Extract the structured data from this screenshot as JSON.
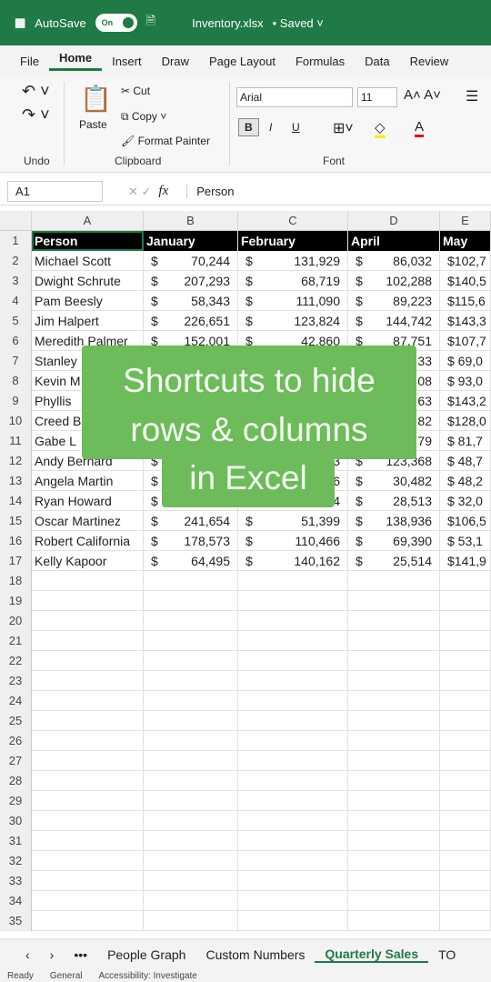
{
  "titlebar": {
    "autosave": "AutoSave",
    "toggle": "On",
    "filename": "Inventory.xlsx",
    "saved": "• Saved ˅"
  },
  "menu": [
    "File",
    "Home",
    "Insert",
    "Draw",
    "Page Layout",
    "Formulas",
    "Data",
    "Review"
  ],
  "ribbon": {
    "undo_group": "Undo",
    "paste": "Paste",
    "cut": "Cut",
    "copy": "Copy",
    "format_painter": "Format Painter",
    "clipboard_group": "Clipboard",
    "font_name": "Arial",
    "font_size": "11",
    "bold": "B",
    "italic": "I",
    "underline": "U",
    "font_group": "Font"
  },
  "formula_bar": {
    "name_box": "A1",
    "fx": "fx",
    "value": "Person"
  },
  "columns": [
    "A",
    "B",
    "C",
    "D",
    "E"
  ],
  "header_row": [
    "Person",
    "January",
    "February",
    "April",
    "May"
  ],
  "rows": [
    {
      "n": "2",
      "name": "Michael Scott",
      "b": "70,244",
      "c": "131,929",
      "d": "86,032",
      "e": "$102,7"
    },
    {
      "n": "3",
      "name": "Dwight Schrute",
      "b": "207,293",
      "c": "68,719",
      "d": "102,288",
      "e": "$140,5"
    },
    {
      "n": "4",
      "name": "Pam Beesly",
      "b": "58,343",
      "c": "111,090",
      "d": "89,223",
      "e": "$115,6"
    },
    {
      "n": "5",
      "name": "Jim Halpert",
      "b": "226,651",
      "c": "123,824",
      "d": "144,742",
      "e": "$143,3"
    },
    {
      "n": "6",
      "name": "Meredith Palmer",
      "b": "152,001",
      "c": "42,860",
      "d": "87,751",
      "e": "$107,7"
    },
    {
      "n": "7",
      "name": "Stanley",
      "b": "",
      "c": "",
      "d": "33",
      "e": "$ 69,0"
    },
    {
      "n": "8",
      "name": "Kevin M",
      "b": "",
      "c": "",
      "d": "08",
      "e": "$ 93,0"
    },
    {
      "n": "9",
      "name": "Phyllis",
      "b": "",
      "c": "",
      "d": "63",
      "e": "$143,2"
    },
    {
      "n": "10",
      "name": "Creed B",
      "b": "",
      "c": "",
      "d": "82",
      "e": "$128,0"
    },
    {
      "n": "11",
      "name": "Gabe L",
      "b": "",
      "c": "",
      "d": "79",
      "e": "$ 81,7"
    },
    {
      "n": "12",
      "name": "Andy Bernard",
      "b": "",
      "c": "3",
      "d": "123,368",
      "e": "$ 48,7"
    },
    {
      "n": "13",
      "name": "Angela Martin",
      "b": "",
      "c": "6",
      "d": "30,482",
      "e": "$ 48,2"
    },
    {
      "n": "14",
      "name": "Ryan Howard",
      "b": "",
      "c": "4",
      "d": "28,513",
      "e": "$ 32,0"
    },
    {
      "n": "15",
      "name": "Oscar Martinez",
      "b": "241,654",
      "c": "51,399",
      "d": "138,936",
      "e": "$106,5"
    },
    {
      "n": "16",
      "name": "Robert California",
      "b": "178,573",
      "c": "110,466",
      "d": "69,390",
      "e": "$ 53,1"
    },
    {
      "n": "17",
      "name": "Kelly Kapoor",
      "b": "64,495",
      "c": "140,162",
      "d": "25,514",
      "e": "$141,9"
    }
  ],
  "currency": "$",
  "overlay": {
    "line1": "Shortcuts to hide",
    "line2": "rows & columns",
    "line3": "in Excel",
    "color": "#6dbb5a"
  },
  "sheet_tabs": [
    "People Graph",
    "Custom Numbers",
    "Quarterly Sales",
    "TO"
  ],
  "more": "•••",
  "status": {
    "ready": "Ready",
    "general": "General",
    "accessibility": "Accessibility: Investigate"
  },
  "accent": "#1f7a45"
}
